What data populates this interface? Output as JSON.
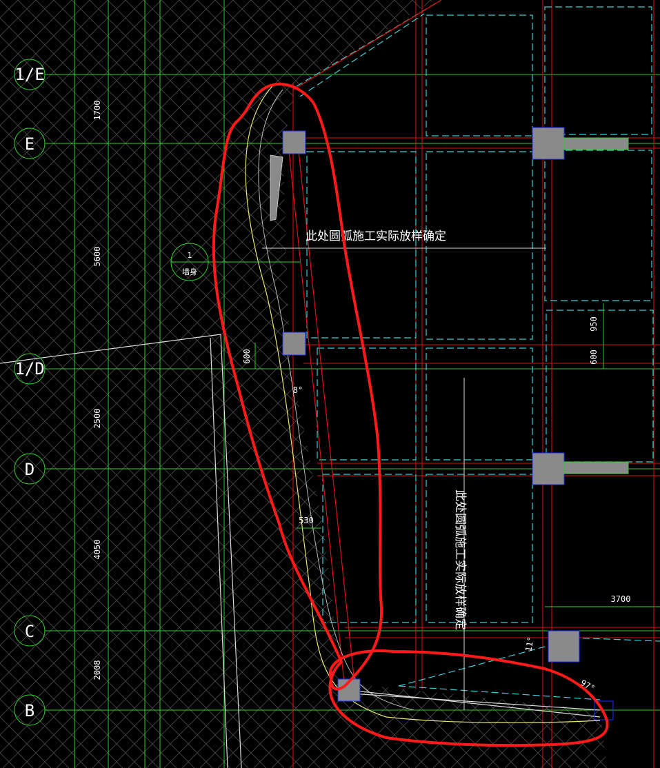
{
  "axes": [
    {
      "label": "1/E"
    },
    {
      "label": "E"
    },
    {
      "label": "1/D"
    },
    {
      "label": "D"
    },
    {
      "label": "C"
    },
    {
      "label": "B"
    }
  ],
  "dimensions": {
    "d1700": "1700",
    "d5600": "5600",
    "d2500": "2500",
    "d4050": "4050",
    "d2008": "2008",
    "d600a": "600",
    "d950": "950",
    "d600b": "600",
    "d530": "530",
    "d3700": "3700",
    "ang8": "8°",
    "ang11": "11°",
    "ang97": "97°"
  },
  "notes": {
    "horizontal": "此处圆弧施工实际放样确定",
    "vertical": "此处圆弧施工实际放样确定"
  },
  "section_tag": {
    "number": "1",
    "label": "墙身"
  },
  "colors": {
    "background": "#000000",
    "grid_green": "#2bd12b",
    "axis_red": "#e01010",
    "dash_cyan": "#39d0d8",
    "yellow": "#e8e870",
    "column_grey": "#8a8a8a",
    "markup_red": "#ff1a1a"
  }
}
